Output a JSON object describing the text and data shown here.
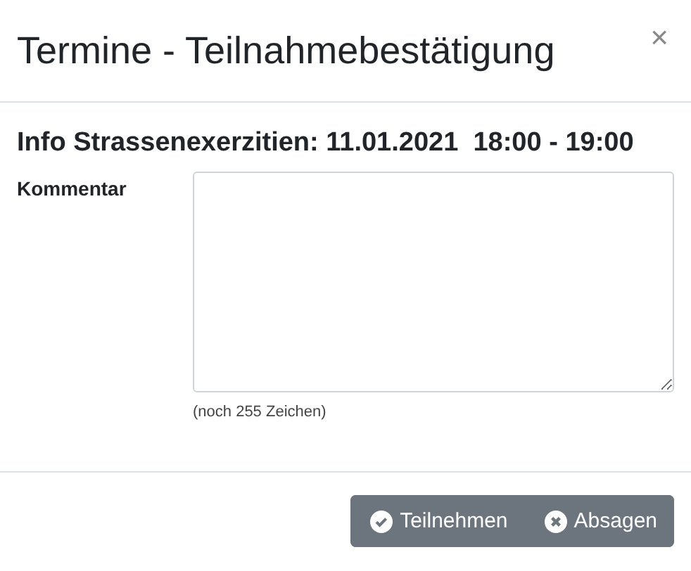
{
  "dialog": {
    "title": "Termine - Teilnahmebestätigung",
    "close": "×"
  },
  "event_heading": "Info Strassenexerzitien: 11.01.2021  18:00 - 19:00",
  "comment": {
    "label": "Kommentar",
    "hint": "(noch 255 Zeichen)"
  },
  "buttons": [
    {
      "kind": "accept",
      "label": "Teilnehmen"
    },
    {
      "kind": "decline",
      "label": "Absagen"
    }
  ]
}
